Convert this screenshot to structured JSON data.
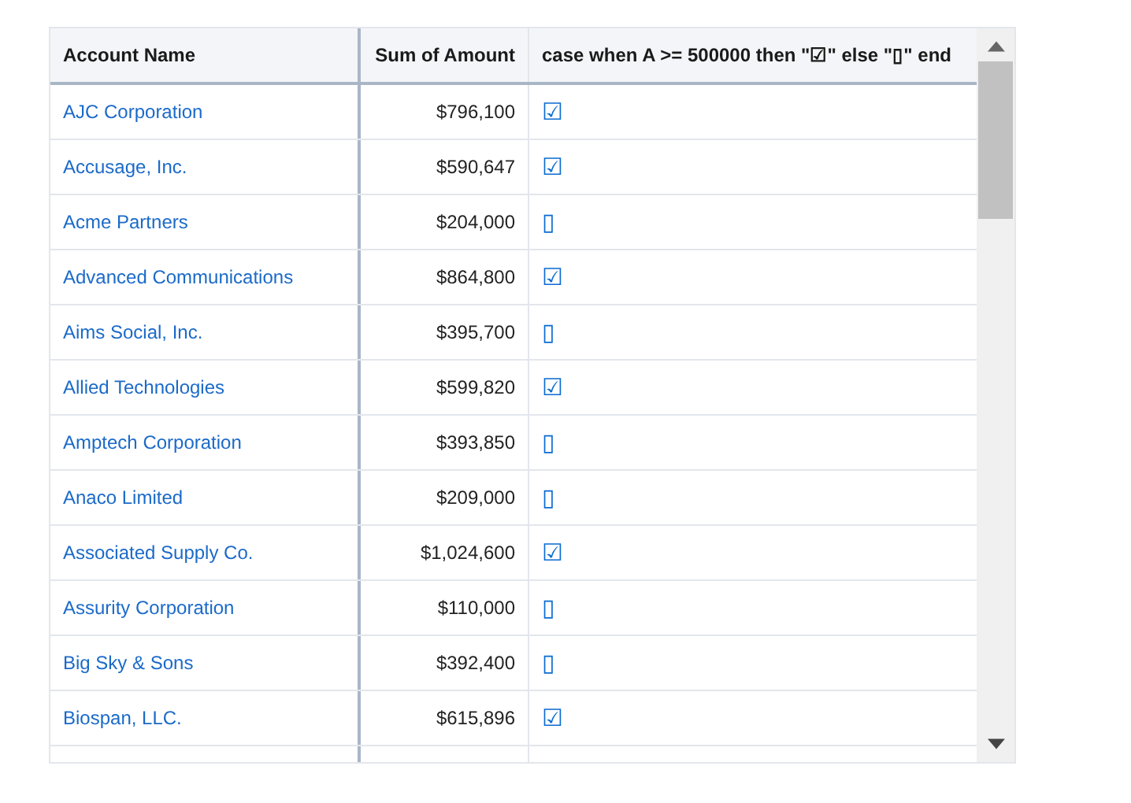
{
  "table": {
    "columns": [
      "Account Name",
      "Sum of Amount",
      "case when A >= 500000 then \"☑\" else \"▯\" end"
    ],
    "rows": [
      {
        "account": "AJC Corporation",
        "amount": "$796,100",
        "flag": "☑"
      },
      {
        "account": "Accusage, Inc.",
        "amount": "$590,647",
        "flag": "☑"
      },
      {
        "account": "Acme Partners",
        "amount": "$204,000",
        "flag": "▯"
      },
      {
        "account": "Advanced Communications",
        "amount": "$864,800",
        "flag": "☑"
      },
      {
        "account": "Aims Social, Inc.",
        "amount": "$395,700",
        "flag": "▯"
      },
      {
        "account": "Allied Technologies",
        "amount": "$599,820",
        "flag": "☑"
      },
      {
        "account": "Amptech Corporation",
        "amount": "$393,850",
        "flag": "▯"
      },
      {
        "account": "Anaco Limited",
        "amount": "$209,000",
        "flag": "▯"
      },
      {
        "account": "Associated Supply Co.",
        "amount": "$1,024,600",
        "flag": "☑"
      },
      {
        "account": "Assurity Corporation",
        "amount": "$110,000",
        "flag": "▯"
      },
      {
        "account": "Big Sky & Sons",
        "amount": "$392,400",
        "flag": "▯"
      },
      {
        "account": "Biospan, LLC.",
        "amount": "$615,896",
        "flag": "☑"
      }
    ]
  }
}
